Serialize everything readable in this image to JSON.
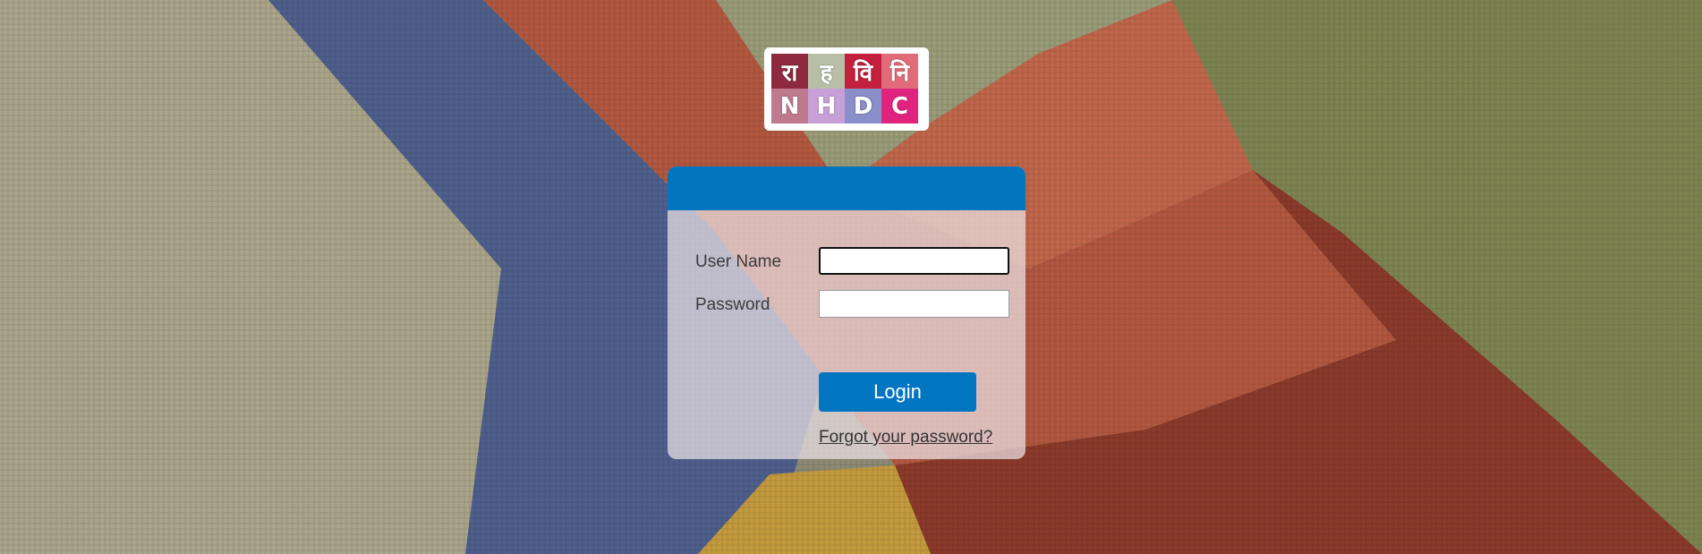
{
  "logo": {
    "top_row": [
      "रा",
      "ह",
      "वि",
      "नि"
    ],
    "bottom_row": [
      "N",
      "H",
      "D",
      "C"
    ],
    "top_colors": [
      "#8e2a3f",
      "#b9bfa6",
      "#c41f3c",
      "#e26b79"
    ],
    "bottom_colors": [
      "#c07a8e",
      "#c8a0d8",
      "#8a8fc9",
      "#e0237f"
    ]
  },
  "login_form": {
    "header_color": "#0275be",
    "username_label": "User Name",
    "username_value": "",
    "password_label": "Password",
    "password_value": "",
    "login_button": "Login",
    "forgot_password_link": "Forgot your password?"
  }
}
